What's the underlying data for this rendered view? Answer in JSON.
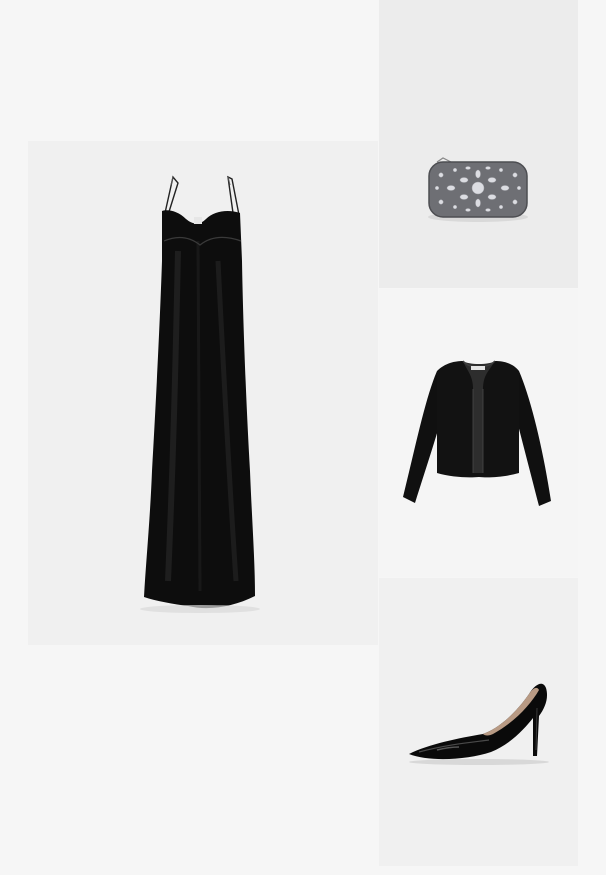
{
  "collage": {
    "background_color": "#f6f6f6",
    "items": [
      {
        "id": "dress",
        "image": "black-slip-dress",
        "background_color": "#f0f0f0"
      },
      {
        "id": "clutch",
        "image": "embellished-clutch",
        "background_color": "#ececec"
      },
      {
        "id": "jacket",
        "image": "black-cropped-jacket",
        "background_color": "#f5f5f5"
      },
      {
        "id": "pumps",
        "image": "black-patent-pumps",
        "background_color": "#f0f0f0"
      }
    ]
  }
}
